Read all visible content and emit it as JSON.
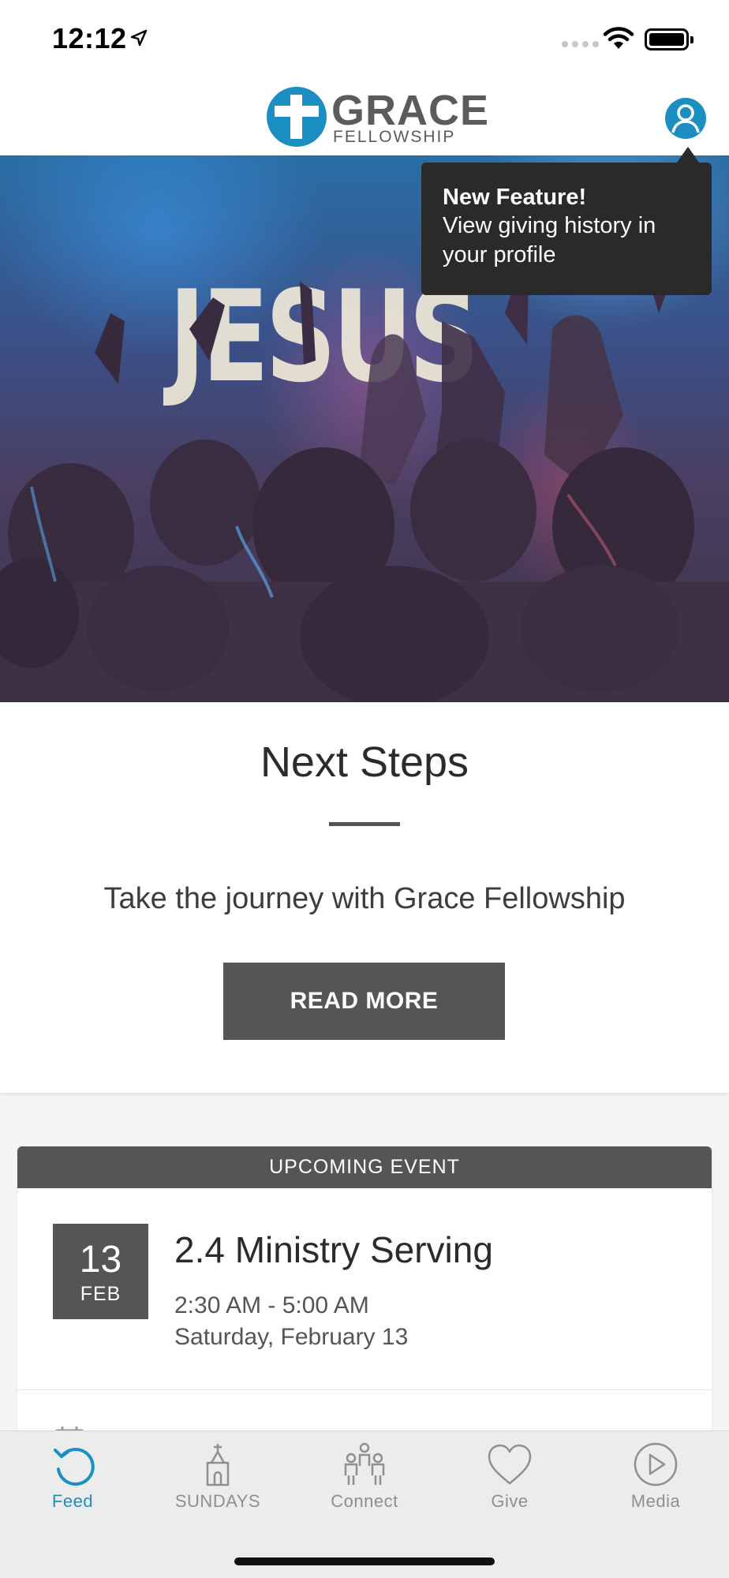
{
  "status_bar": {
    "time": "12:12"
  },
  "header": {
    "logo_word": "GRACE",
    "logo_sub": "FELLOWSHIP",
    "brand_color": "#1b8ec2"
  },
  "hero": {
    "overlay_text": "JESUS"
  },
  "tooltip": {
    "title": "New Feature!",
    "body": "View giving history in your profile"
  },
  "next_steps": {
    "title": "Next Steps",
    "subtitle": "Take the journey with Grace Fellowship",
    "button_label": "READ MORE"
  },
  "event": {
    "header": "UPCOMING EVENT",
    "day": "13",
    "month": "FEB",
    "title": "2.4 Ministry Serving",
    "time": "2:30 AM - 5:00 AM",
    "date": "Saturday, February 13"
  },
  "tabs": [
    {
      "label": "Feed",
      "icon": "refresh-icon",
      "active": true
    },
    {
      "label": "SUNDAYS",
      "icon": "church-icon",
      "active": false
    },
    {
      "label": "Connect",
      "icon": "people-icon",
      "active": false
    },
    {
      "label": "Give",
      "icon": "heart-icon",
      "active": false
    },
    {
      "label": "Media",
      "icon": "play-icon",
      "active": false
    }
  ]
}
